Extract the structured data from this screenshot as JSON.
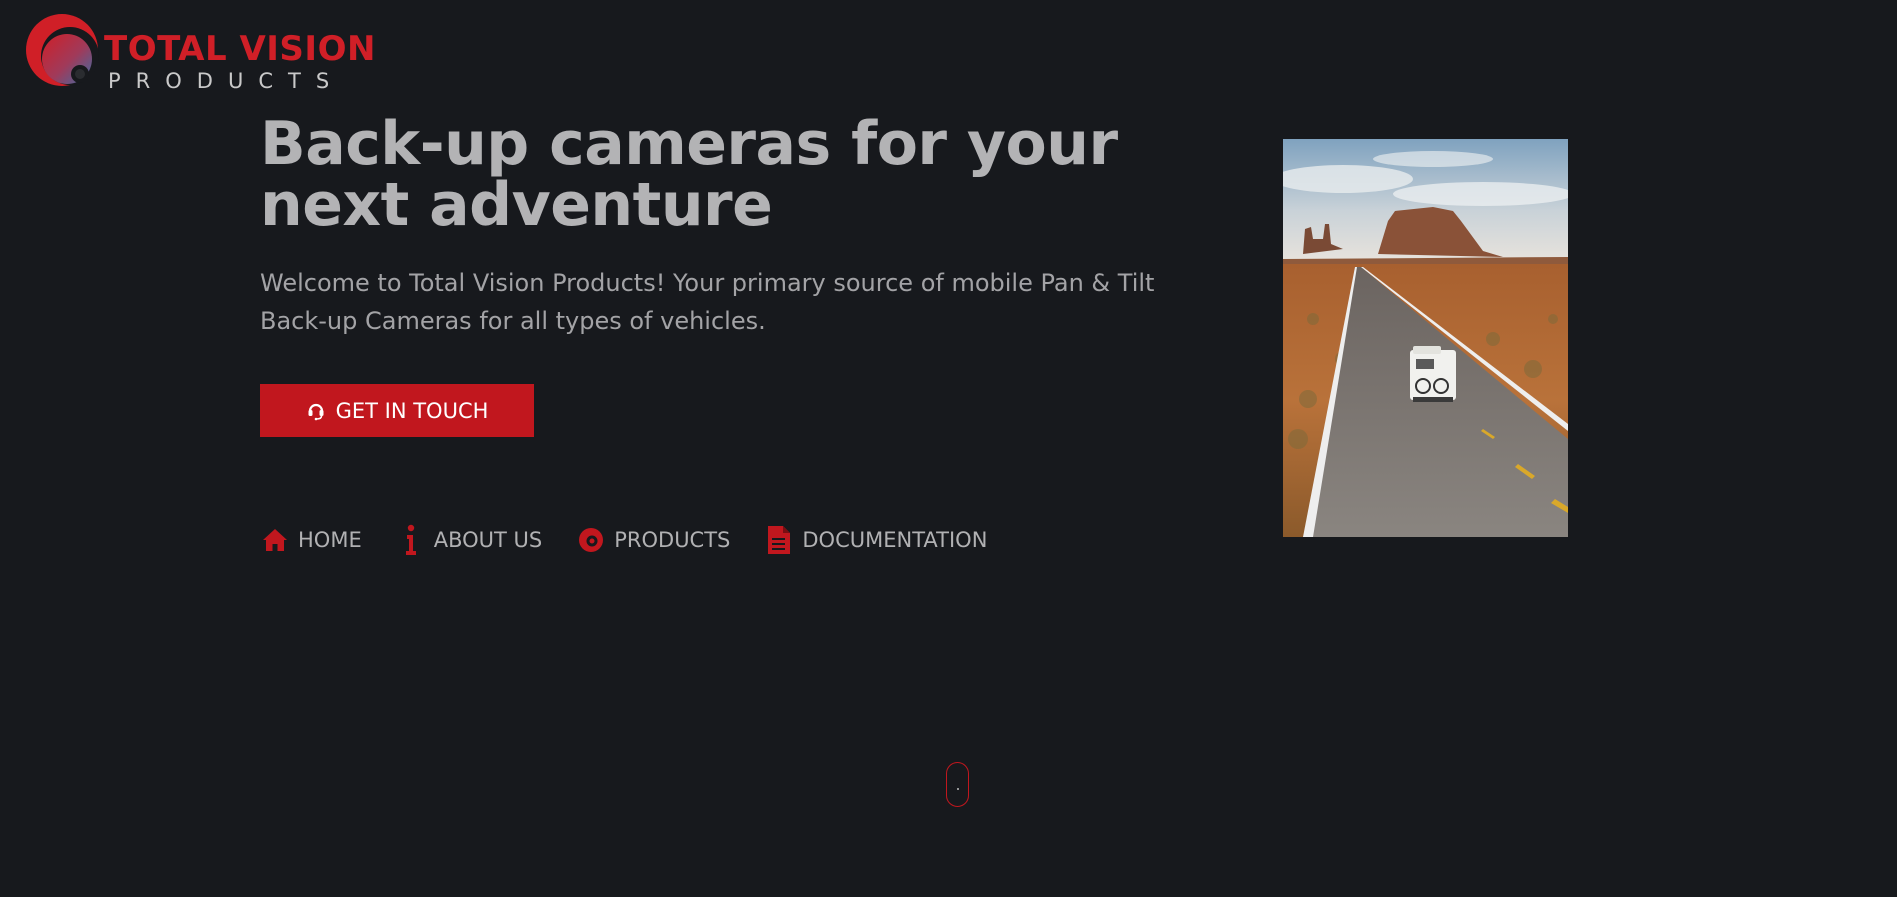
{
  "logo": {
    "line1": "TOTAL VISION",
    "line2": "PRODUCTS"
  },
  "hero": {
    "title": "Back-up cameras for your next adventure",
    "subtitle": "Welcome to Total Vision Products! Your primary source of mobile Pan & Tilt Back-up Cameras for all types of vehicles.",
    "cta_label": "GET IN TOUCH",
    "cta_icon": "headset-icon"
  },
  "nav": {
    "items": [
      {
        "label": "HOME",
        "icon": "home-icon"
      },
      {
        "label": "ABOUT US",
        "icon": "info-icon"
      },
      {
        "label": "PRODUCTS",
        "icon": "camera-lens-icon"
      },
      {
        "label": "DOCUMENTATION",
        "icon": "document-icon"
      }
    ]
  },
  "colors": {
    "background": "#17191d",
    "accent": "#c1171e",
    "brand_red": "#d01f27",
    "heading": "#b3b3b5",
    "body_text": "#a3a3a6"
  }
}
